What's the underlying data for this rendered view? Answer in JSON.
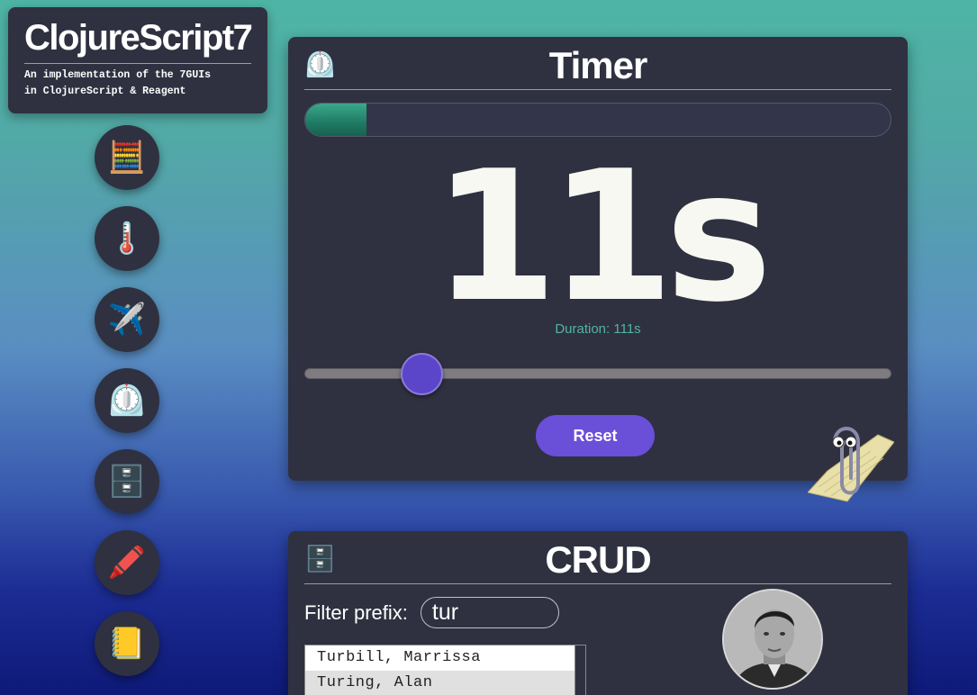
{
  "brand": {
    "title": "ClojureScript7",
    "subtitle": "An implementation of the 7GUIs\nin ClojureScript & Reagent"
  },
  "nav": [
    {
      "icon": "abacus-icon",
      "glyph": "🧮"
    },
    {
      "icon": "thermometer-icon",
      "glyph": "🌡️"
    },
    {
      "icon": "airplane-icon",
      "glyph": "✈️"
    },
    {
      "icon": "timer-icon",
      "glyph": "⏲️"
    },
    {
      "icon": "file-cabinet-icon",
      "glyph": "🗄️"
    },
    {
      "icon": "crayon-icon",
      "glyph": "🖍️"
    },
    {
      "icon": "notebook-icon",
      "glyph": "📒"
    }
  ],
  "timer": {
    "icon": "⏲️",
    "title": "Timer",
    "elapsed_fraction": 0.105,
    "elapsed_display": "11s",
    "duration_label": "Duration: 111s",
    "slider_fraction": 0.2,
    "reset_label": "Reset"
  },
  "crud": {
    "icon": "🗄️",
    "title": "CRUD",
    "filter_label": "Filter prefix:",
    "filter_value": "tur",
    "items": [
      "Turbill, Marrissa",
      "Turing, Alan"
    ],
    "selected_index": 1
  },
  "colors": {
    "panel_bg": "#2f3140",
    "accent_purple": "#6a4fd8",
    "progress_green": "#1f7a64",
    "duration_teal": "#4fb5a4"
  }
}
